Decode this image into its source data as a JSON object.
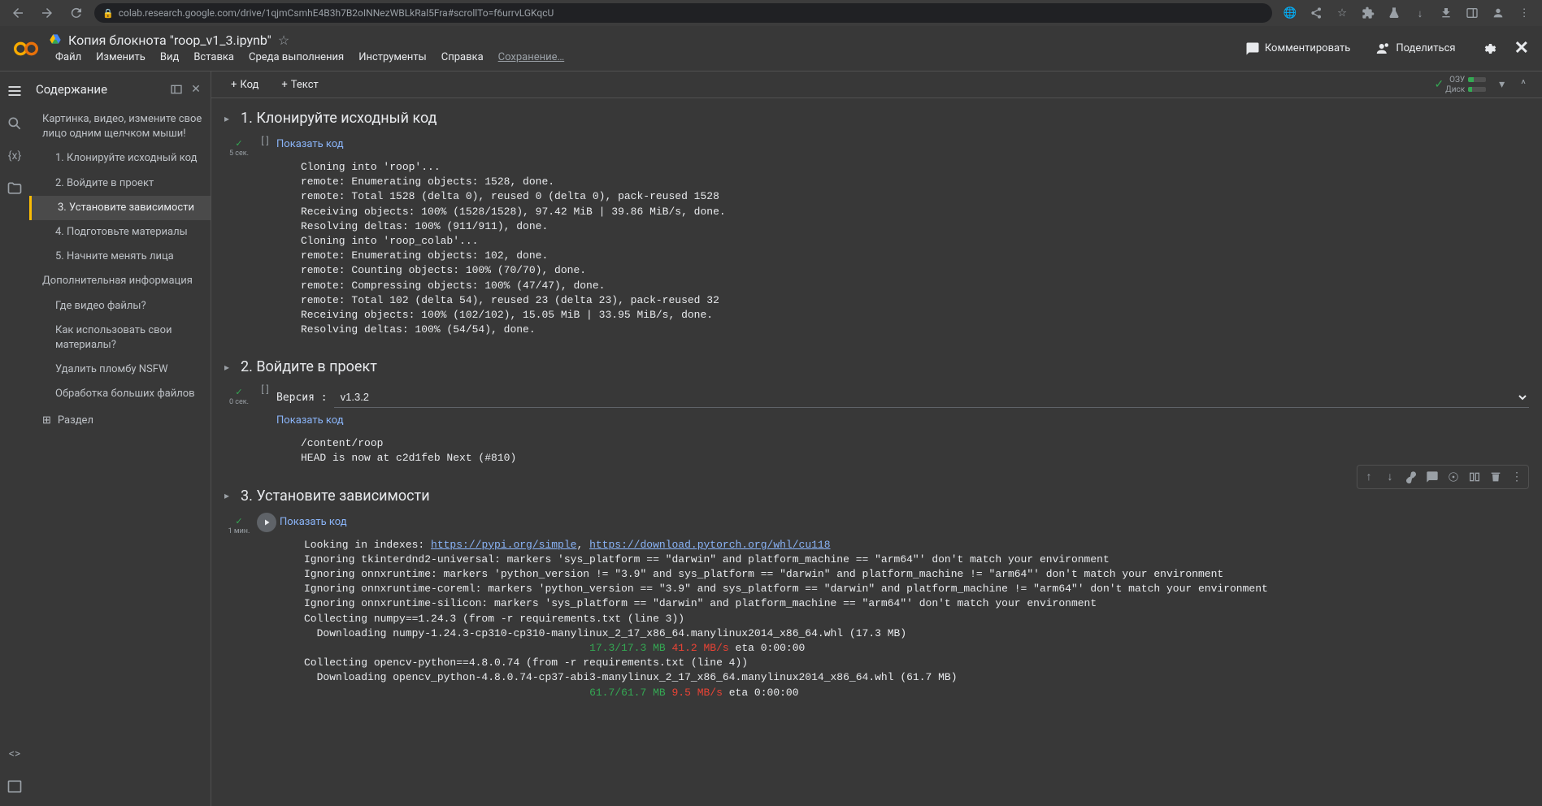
{
  "chrome": {
    "url": "colab.research.google.com/drive/1qjmCsmhE4B3h7B2oINNezWBLkRal5Fra#scrollTo=f6urrvLGKqcU"
  },
  "header": {
    "title": "Копия блокнота \"roop_v1_3.ipynb\"",
    "menus": [
      "Файл",
      "Изменить",
      "Вид",
      "Вставка",
      "Среда выполнения",
      "Инструменты",
      "Справка"
    ],
    "saving": "Сохранение…",
    "comment": "Комментировать",
    "share": "Поделиться"
  },
  "sidebar": {
    "title": "Содержание",
    "items": [
      {
        "text": "Картинка, видео, измените свое лицо одним щелчком мыши!",
        "level": 0
      },
      {
        "text": "1. Клонируйте исходный код",
        "level": 1
      },
      {
        "text": "2. Войдите в проект",
        "level": 1
      },
      {
        "text": "3. Установите зависимости",
        "level": 1,
        "active": true
      },
      {
        "text": "4. Подготовьте материалы",
        "level": 1
      },
      {
        "text": "5. Начните менять лица",
        "level": 1
      },
      {
        "text": "Дополнительная информация",
        "level": 0
      },
      {
        "text": "Где видео файлы?",
        "level": 1
      },
      {
        "text": "Как использовать свои материалы?",
        "level": 1
      },
      {
        "text": "Удалить пломбу NSFW",
        "level": 1
      },
      {
        "text": "Обработка больших файлов",
        "level": 1
      }
    ],
    "add_section": "Раздел"
  },
  "toolbar": {
    "code_btn": "Код",
    "text_btn": "Текст",
    "ram_label": "ОЗУ",
    "disk_label": "Диск"
  },
  "sections": {
    "s1": {
      "title": "1. Клонируйте исходный код",
      "exec_time": "5\nсек.",
      "show_code": "Показать код",
      "output": "Cloning into 'roop'...\nremote: Enumerating objects: 1528, done.\nremote: Total 1528 (delta 0), reused 0 (delta 0), pack-reused 1528\nReceiving objects: 100% (1528/1528), 97.42 MiB | 39.86 MiB/s, done.\nResolving deltas: 100% (911/911), done.\nCloning into 'roop_colab'...\nremote: Enumerating objects: 102, done.\nremote: Counting objects: 100% (70/70), done.\nremote: Compressing objects: 100% (47/47), done.\nremote: Total 102 (delta 54), reused 23 (delta 23), pack-reused 32\nReceiving objects: 100% (102/102), 15.05 MiB | 33.95 MiB/s, done.\nResolving deltas: 100% (54/54), done."
    },
    "s2": {
      "title": "2. Войдите в проект",
      "exec_time": "0\nсек.",
      "form_label": "Версия :",
      "form_value": "v1.3.2",
      "show_code": "Показать код",
      "output": "/content/roop\nHEAD is now at c2d1feb Next (#810)"
    },
    "s3": {
      "title": "3. Установите зависимости",
      "exec_time": "1\nмин.",
      "show_code": "Показать код",
      "output_pre": "Looking in indexes: ",
      "link1": "https://pypi.org/simple",
      "link2": "https://download.pytorch.org/whl/cu118",
      "output_mid": "Ignoring tkinterdnd2-universal: markers 'sys_platform == \"darwin\" and platform_machine == \"arm64\"' don't match your environment\nIgnoring onnxruntime: markers 'python_version != \"3.9\" and sys_platform == \"darwin\" and platform_machine != \"arm64\"' don't match your environment\nIgnoring onnxruntime-coreml: markers 'python_version == \"3.9\" and sys_platform == \"darwin\" and platform_machine != \"arm64\"' don't match your environment\nIgnoring onnxruntime-silicon: markers 'sys_platform == \"darwin\" and platform_machine == \"arm64\"' don't match your environment\nCollecting numpy==1.24.3 (from -r requirements.txt (line 3))\n  Downloading numpy-1.24.3-cp310-cp310-manylinux_2_17_x86_64.manylinux2014_x86_64.whl (17.3 MB)",
      "progress1_size": "17.3/17.3 MB",
      "progress1_speed": "41.2 MB/s",
      "progress1_eta": " eta 0:00:00",
      "output_mid2": "Collecting opencv-python==4.8.0.74 (from -r requirements.txt (line 4))\n  Downloading opencv_python-4.8.0.74-cp37-abi3-manylinux_2_17_x86_64.manylinux2014_x86_64.whl (61.7 MB)",
      "progress2_size": "61.7/61.7 MB",
      "progress2_speed": "9.5 MB/s",
      "progress2_eta": " eta 0:00:00"
    }
  }
}
